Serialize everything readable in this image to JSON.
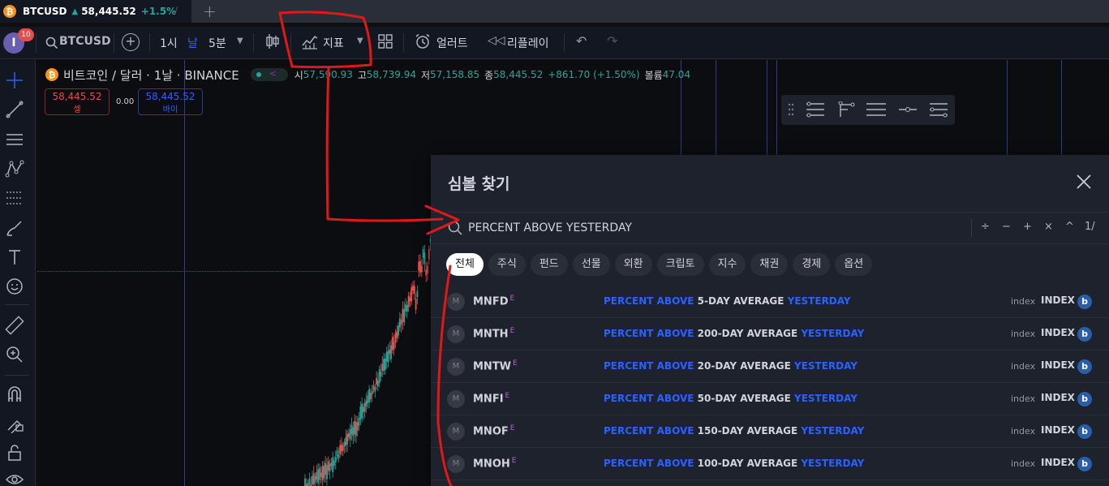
{
  "tab": {
    "symbol": "BTCUSD",
    "arrow": "▲",
    "price": "58,445.52",
    "change": "+1.5%",
    "close": "/",
    "add": "+"
  },
  "toolbar": {
    "avatar_letter": "I",
    "notifications": "10",
    "search_label": "BTCUSD",
    "interval_1h": "1시",
    "interval_day": "날",
    "interval_5m": "5분",
    "indicators_label": "지표",
    "alert_label": "얼러트",
    "replay_label": "리플레이"
  },
  "chart": {
    "symbol_title": "비트코인 / 달러 · 1날 · BINANCE",
    "ohlc": [
      {
        "key": "시",
        "value": "57,590.93"
      },
      {
        "key": "고",
        "value": "58,739.94"
      },
      {
        "key": "저",
        "value": "57,158.85"
      },
      {
        "key": "종",
        "value": "58,445.52"
      }
    ],
    "change": "+861.70 (+1.50%)",
    "volume_label": "볼륨",
    "volume_value": "47.04",
    "sell_price": "58,445.52",
    "sell_label": "셀",
    "spread": "0.00",
    "buy_price": "58,445.52",
    "buy_label": "바이",
    "colors": {
      "up": "#26a69a",
      "down": "#ef5350",
      "accent": "#2962ff"
    }
  },
  "dialog": {
    "title": "심볼 찾기",
    "search_value": "PERCENT ABOVE YESTERDAY",
    "operators": [
      "÷",
      "−",
      "+",
      "×",
      "^",
      "1/"
    ],
    "filters": [
      "전체",
      "주식",
      "펀드",
      "선물",
      "외환",
      "크립토",
      "지수",
      "채권",
      "경제",
      "옵션"
    ],
    "results": [
      {
        "logo": "M",
        "symbol": "MNFD",
        "sup": "E",
        "hl1": "PERCENT ABOVE",
        "mid": "5-DAY AVERAGE",
        "hl2": "YESTERDAY",
        "type": "index",
        "exchange": "INDEX",
        "source": "b"
      },
      {
        "logo": "M",
        "symbol": "MNTH",
        "sup": "E",
        "hl1": "PERCENT ABOVE",
        "mid": "200-DAY AVERAGE",
        "hl2": "YESTERDAY",
        "type": "index",
        "exchange": "INDEX",
        "source": "b"
      },
      {
        "logo": "M",
        "symbol": "MNTW",
        "sup": "E",
        "hl1": "PERCENT ABOVE",
        "mid": "20-DAY AVERAGE",
        "hl2": "YESTERDAY",
        "type": "index",
        "exchange": "INDEX",
        "source": "b"
      },
      {
        "logo": "M",
        "symbol": "MNFI",
        "sup": "E",
        "hl1": "PERCENT ABOVE",
        "mid": "50-DAY AVERAGE",
        "hl2": "YESTERDAY",
        "type": "index",
        "exchange": "INDEX",
        "source": "b"
      },
      {
        "logo": "M",
        "symbol": "MNOF",
        "sup": "E",
        "hl1": "PERCENT ABOVE",
        "mid": "150-DAY AVERAGE",
        "hl2": "YESTERDAY",
        "type": "index",
        "exchange": "INDEX",
        "source": "b"
      },
      {
        "logo": "M",
        "symbol": "MNOH",
        "sup": "E",
        "hl1": "PERCENT ABOVE",
        "mid": "100-DAY AVERAGE",
        "hl2": "YESTERDAY",
        "type": "index",
        "exchange": "INDEX",
        "source": "b"
      }
    ]
  }
}
